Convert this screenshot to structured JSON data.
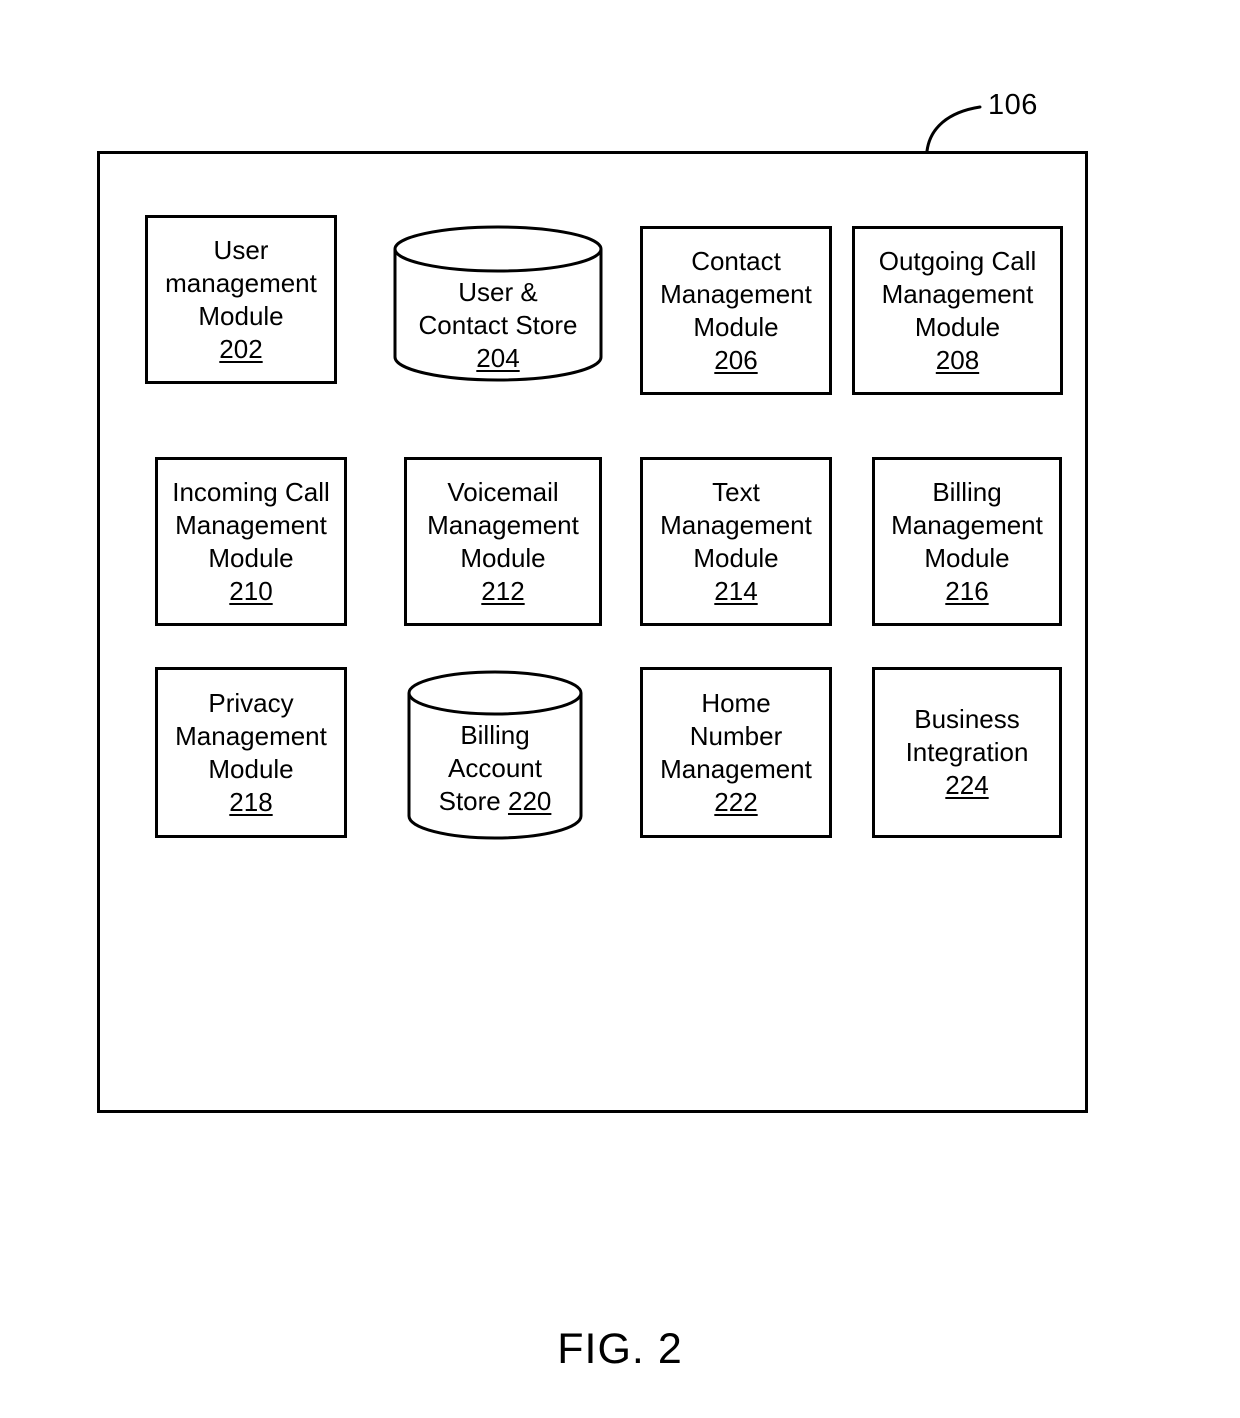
{
  "figure": {
    "caption": "FIG. 2",
    "system_reference": "106"
  },
  "diagram": {
    "type": "block-diagram",
    "container_label": "106",
    "nodes": [
      {
        "id": "202",
        "shape": "rectangle",
        "row": 1,
        "column": 1,
        "lines": [
          "User",
          "management",
          "Module"
        ],
        "number": "202",
        "number_inline": false
      },
      {
        "id": "204",
        "shape": "cylinder",
        "row": 1,
        "column": 2,
        "lines": [
          "User &",
          "Contact Store"
        ],
        "number": "204",
        "number_inline": false
      },
      {
        "id": "206",
        "shape": "rectangle",
        "row": 1,
        "column": 3,
        "lines": [
          "Contact",
          "Management",
          "Module"
        ],
        "number": "206",
        "number_inline": false
      },
      {
        "id": "208",
        "shape": "rectangle",
        "row": 1,
        "column": 4,
        "lines": [
          "Outgoing Call",
          "Management",
          "Module"
        ],
        "number": "208",
        "number_inline": false
      },
      {
        "id": "210",
        "shape": "rectangle",
        "row": 2,
        "column": 1,
        "lines": [
          "Incoming Call",
          "Management",
          "Module"
        ],
        "number": "210",
        "number_inline": false
      },
      {
        "id": "212",
        "shape": "rectangle",
        "row": 2,
        "column": 2,
        "lines": [
          "Voicemail",
          "Management",
          "Module"
        ],
        "number": "212",
        "number_inline": false
      },
      {
        "id": "214",
        "shape": "rectangle",
        "row": 2,
        "column": 3,
        "lines": [
          "Text",
          "Management",
          "Module"
        ],
        "number": "214",
        "number_inline": false
      },
      {
        "id": "216",
        "shape": "rectangle",
        "row": 2,
        "column": 4,
        "lines": [
          "Billing",
          "Management",
          "Module"
        ],
        "number": "216",
        "number_inline": false
      },
      {
        "id": "218",
        "shape": "rectangle",
        "row": 3,
        "column": 1,
        "lines": [
          "Privacy",
          "Management",
          "Module"
        ],
        "number": "218",
        "number_inline": false
      },
      {
        "id": "220",
        "shape": "cylinder",
        "row": 3,
        "column": 2,
        "lines": [
          "Billing",
          "Account",
          "Store "
        ],
        "number": "220",
        "number_inline": true
      },
      {
        "id": "222",
        "shape": "rectangle",
        "row": 3,
        "column": 3,
        "lines": [
          "Home",
          "Number",
          "Management"
        ],
        "number": "222",
        "number_inline": false
      },
      {
        "id": "224",
        "shape": "rectangle",
        "row": 3,
        "column": 4,
        "lines": [
          "Business",
          "Integration"
        ],
        "number": "224",
        "number_inline": false
      }
    ]
  },
  "nodes": {
    "n202": {
      "l1": "User",
      "l2": "management",
      "l3": "Module",
      "num": "202"
    },
    "n204": {
      "l1": "User &",
      "l2": "Contact Store",
      "num": "204"
    },
    "n206": {
      "l1": "Contact",
      "l2": "Management",
      "l3": "Module",
      "num": "206"
    },
    "n208": {
      "l1": "Outgoing Call",
      "l2": "Management",
      "l3": "Module",
      "num": "208"
    },
    "n210": {
      "l1": "Incoming Call",
      "l2": "Management",
      "l3": "Module",
      "num": "210"
    },
    "n212": {
      "l1": "Voicemail",
      "l2": "Management",
      "l3": "Module",
      "num": "212"
    },
    "n214": {
      "l1": "Text",
      "l2": "Management",
      "l3": "Module",
      "num": "214"
    },
    "n216": {
      "l1": "Billing",
      "l2": "Management",
      "l3": "Module",
      "num": "216"
    },
    "n218": {
      "l1": "Privacy",
      "l2": "Management",
      "l3": "Module",
      "num": "218"
    },
    "n220": {
      "l1": "Billing",
      "l2": "Account",
      "l3": "Store ",
      "num": "220"
    },
    "n222": {
      "l1": "Home",
      "l2": "Number",
      "l3": "Management",
      "num": "222"
    },
    "n224": {
      "l1": "Business",
      "l2": "Integration",
      "num": "224"
    }
  },
  "colors": {
    "stroke": "#000000",
    "fill": "#ffffff",
    "text": "#000000"
  }
}
